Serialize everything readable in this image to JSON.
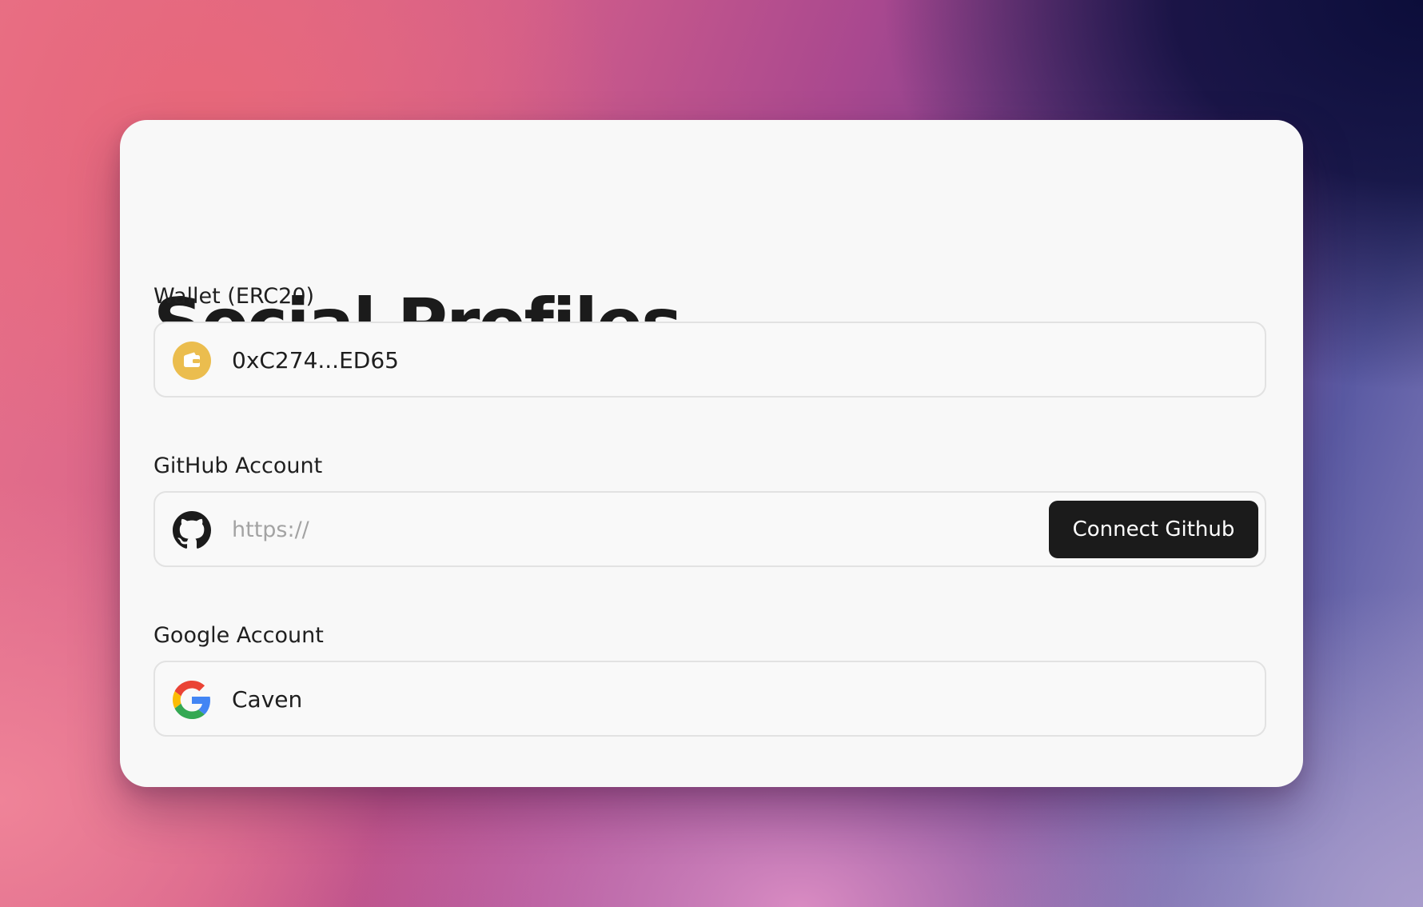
{
  "card": {
    "title": "Social Profiles"
  },
  "wallet": {
    "label": "Wallet (ERC20)",
    "icon": "wallet-icon",
    "value": "0xC274...ED65",
    "icon_color": "#ebbd4e"
  },
  "github": {
    "label": "GitHub Account",
    "icon": "github-icon",
    "placeholder": "https://",
    "value": "",
    "button_label": "Connect Github",
    "button_color": "#1b1b1b"
  },
  "google": {
    "label": "Google Account",
    "icon": "google-icon",
    "value": "Caven"
  }
}
